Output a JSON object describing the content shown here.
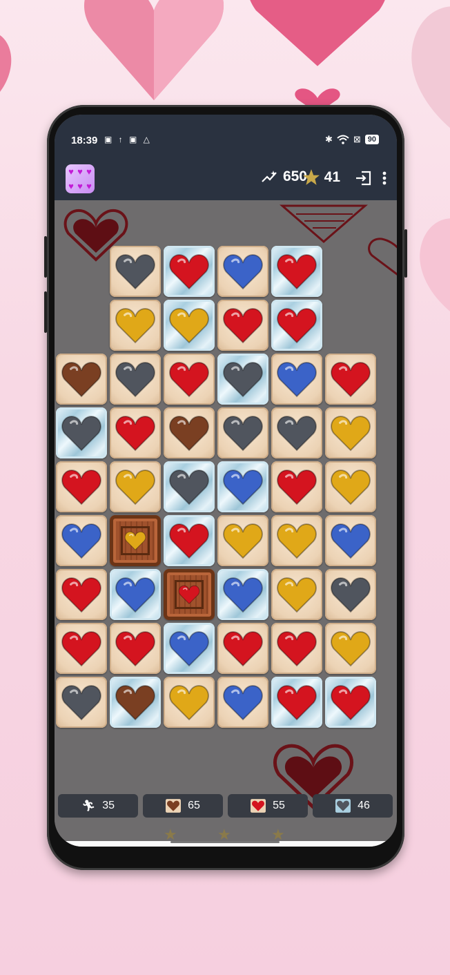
{
  "status_bar": {
    "time": "18:39",
    "left_icons": "▣ ↑ ▣ △",
    "battery": "90"
  },
  "app_bar": {
    "app_icon_name": "hearts-app-icon",
    "score": "650",
    "stars": "41"
  },
  "board": {
    "columns": 6,
    "rows": 9,
    "cells": [
      [
        null,
        {
          "color": "gray",
          "tile": "plain"
        },
        {
          "color": "red",
          "tile": "ice"
        },
        {
          "color": "blue",
          "tile": "plain"
        },
        {
          "color": "red",
          "tile": "ice"
        },
        null
      ],
      [
        null,
        {
          "color": "gold",
          "tile": "plain"
        },
        {
          "color": "gold",
          "tile": "ice"
        },
        {
          "color": "red",
          "tile": "plain"
        },
        {
          "color": "red",
          "tile": "ice"
        },
        null
      ],
      [
        {
          "color": "brown",
          "tile": "plain"
        },
        {
          "color": "gray",
          "tile": "plain"
        },
        {
          "color": "red",
          "tile": "plain"
        },
        {
          "color": "gray",
          "tile": "ice"
        },
        {
          "color": "blue",
          "tile": "plain"
        },
        {
          "color": "red",
          "tile": "plain"
        }
      ],
      [
        {
          "color": "gray",
          "tile": "ice"
        },
        {
          "color": "red",
          "tile": "plain"
        },
        {
          "color": "brown",
          "tile": "plain"
        },
        {
          "color": "gray",
          "tile": "plain"
        },
        {
          "color": "gray",
          "tile": "plain"
        },
        {
          "color": "gold",
          "tile": "plain"
        }
      ],
      [
        {
          "color": "red",
          "tile": "plain"
        },
        {
          "color": "gold",
          "tile": "plain"
        },
        {
          "color": "gray",
          "tile": "ice"
        },
        {
          "color": "blue",
          "tile": "ice"
        },
        {
          "color": "red",
          "tile": "plain"
        },
        {
          "color": "gold",
          "tile": "plain"
        }
      ],
      [
        {
          "color": "blue",
          "tile": "plain"
        },
        {
          "color": "gold",
          "tile": "crate"
        },
        {
          "color": "red",
          "tile": "ice"
        },
        {
          "color": "gold",
          "tile": "plain"
        },
        {
          "color": "gold",
          "tile": "plain"
        },
        {
          "color": "blue",
          "tile": "plain"
        }
      ],
      [
        {
          "color": "red",
          "tile": "plain"
        },
        {
          "color": "blue",
          "tile": "ice"
        },
        {
          "color": "red",
          "tile": "crate"
        },
        {
          "color": "blue",
          "tile": "ice"
        },
        {
          "color": "gold",
          "tile": "plain"
        },
        {
          "color": "gray",
          "tile": "plain"
        }
      ],
      [
        {
          "color": "red",
          "tile": "plain"
        },
        {
          "color": "red",
          "tile": "plain"
        },
        {
          "color": "blue",
          "tile": "ice"
        },
        {
          "color": "red",
          "tile": "plain"
        },
        {
          "color": "red",
          "tile": "plain"
        },
        {
          "color": "gold",
          "tile": "plain"
        }
      ],
      [
        {
          "color": "gray",
          "tile": "plain"
        },
        {
          "color": "brown",
          "tile": "ice"
        },
        {
          "color": "gold",
          "tile": "plain"
        },
        {
          "color": "blue",
          "tile": "plain"
        },
        {
          "color": "red",
          "tile": "ice"
        },
        {
          "color": "red",
          "tile": "ice"
        }
      ]
    ]
  },
  "heart_colors": {
    "red": "#d4141f",
    "blue": "#3b63c8",
    "gold": "#e0a818",
    "gray": "#50555e",
    "brown": "#7a3f22"
  },
  "goals": [
    {
      "icon": "moves-runner-icon",
      "value": "35"
    },
    {
      "icon": "brown-heart-icon",
      "value": "65"
    },
    {
      "icon": "red-heart-icon",
      "value": "55"
    },
    {
      "icon": "gray-heart-icon",
      "value": "46"
    }
  ]
}
